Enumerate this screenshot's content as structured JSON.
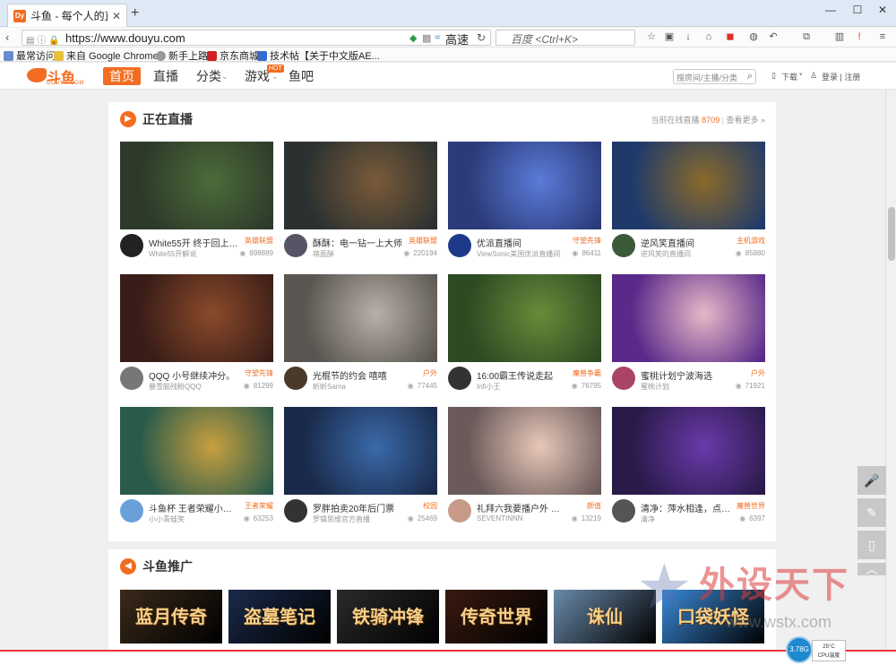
{
  "browser": {
    "tab_title": "斗鱼 - 每个人的直...",
    "favicon_text": "Dy",
    "new_tab": "+",
    "url": "https://www.douyu.com",
    "speed_label": "高速",
    "search_placeholder": "百度 <Ctrl+K>",
    "bookmarks": [
      "最常访问",
      "来自 Google Chrome",
      "新手上路",
      "京东商城",
      "技术帖【关于中文版AE..."
    ]
  },
  "site": {
    "logo_text": "斗鱼",
    "logo_sub": "DOUYU.COM",
    "nav": [
      "首页",
      "直播",
      "分类",
      "游戏",
      "鱼吧"
    ],
    "hot_badge": "HOT",
    "search_placeholder": "搜房间/主播/分类",
    "download": "下载",
    "login": "登录 | 注册"
  },
  "live_section": {
    "title": "正在直播",
    "online_label": "当前在线直播",
    "online_count": "8709",
    "more": "查看更多",
    "cards": [
      {
        "title": "White55开 终于回上海...",
        "category": "英雄联盟",
        "streamer": "White55开解说",
        "viewers": "898889",
        "thumb_color": "#2d3a2a",
        "accent": "#4b6b3a",
        "avatar_color": "#222"
      },
      {
        "title": "酥酥：电一钻一上大师",
        "category": "英雄联盟",
        "streamer": "萌面酥",
        "viewers": "220194",
        "thumb_color": "#2a3130",
        "accent": "#7a5a3a",
        "avatar_color": "#556"
      },
      {
        "title": "优派直播间",
        "category": "守望先锋",
        "streamer": "ViewSonic美国优派直播间",
        "viewers": "86411",
        "thumb_color": "#2b3a78",
        "accent": "#5a7bd8",
        "avatar_color": "#1d3a8a"
      },
      {
        "title": "逆风笑直播间",
        "category": "主机游戏",
        "streamer": "逆风笑的直播间",
        "viewers": "85880",
        "thumb_color": "#1f3a6a",
        "accent": "#8a6a2a",
        "avatar_color": "#3a5a3a"
      },
      {
        "title": "QQQ 小号继续冲分。",
        "category": "守望先锋",
        "streamer": "暴雪脑残粉QQQ",
        "viewers": "81299",
        "thumb_color": "#3a1d18",
        "accent": "#8a4a2a",
        "avatar_color": "#777"
      },
      {
        "title": "光棍节的约会 嘻嘻",
        "category": "户外",
        "streamer": "昕昕Sama",
        "viewers": "77445",
        "thumb_color": "#5a5550",
        "accent": "#b8b0a8",
        "avatar_color": "#4a3a2a"
      },
      {
        "title": "16:00霸王传说走起",
        "category": "魔兽争霸",
        "streamer": "Infi小王",
        "viewers": "76795",
        "thumb_color": "#2d4a22",
        "accent": "#6a8a3a",
        "avatar_color": "#333"
      },
      {
        "title": "蜜桃计划宁波海选",
        "category": "户外",
        "streamer": "蜜桃计划",
        "viewers": "71921",
        "thumb_color": "#5a2a8a",
        "accent": "#e8b8c8",
        "avatar_color": "#aa4466"
      },
      {
        "title": "斗鱼杯 王者荣耀小组赛...",
        "category": "王者荣耀",
        "streamer": "小小青蛙笑",
        "viewers": "63253",
        "thumb_color": "#2a5a4a",
        "accent": "#c8a040",
        "avatar_color": "#6aa0d8"
      },
      {
        "title": "罗胖拍卖20年后门票",
        "category": "校园",
        "streamer": "罗辑思维官方直播",
        "viewers": "25469",
        "thumb_color": "#1a2a4a",
        "accent": "#3a6aaa",
        "avatar_color": "#333"
      },
      {
        "title": "礼拜六我要播户外 记得...",
        "category": "颜值",
        "streamer": "SEVENTINNN",
        "viewers": "13219",
        "thumb_color": "#6a5a5a",
        "accent": "#e8c8b8",
        "avatar_color": "#c89a88"
      },
      {
        "title": "清净：萍水相逢，点个...",
        "category": "魔兽世界",
        "streamer": "清净",
        "viewers": "6397",
        "thumb_color": "#2a1a4a",
        "accent": "#6a3aaa",
        "avatar_color": "#555"
      }
    ]
  },
  "promo_section": {
    "title": "斗鱼推广",
    "items": [
      {
        "label": "蓝月传奇",
        "color": "#3a2a1a"
      },
      {
        "label": "盗墓笔记",
        "color": "#1a2a4a"
      },
      {
        "label": "铁骑冲锋",
        "color": "#2a2a2a"
      },
      {
        "label": "传奇世界",
        "color": "#3a1a10"
      },
      {
        "label": "诛仙",
        "color": "#6a8aaa"
      },
      {
        "label": "口袋妖怪",
        "color": "#3a8ad8"
      }
    ]
  },
  "watermark": {
    "text": "外设天下",
    "url": "www.wstx.com"
  },
  "system": {
    "cpu_usage": "3.78G",
    "cpu_temp": "25°C",
    "cpu_label": "CPU温度"
  }
}
